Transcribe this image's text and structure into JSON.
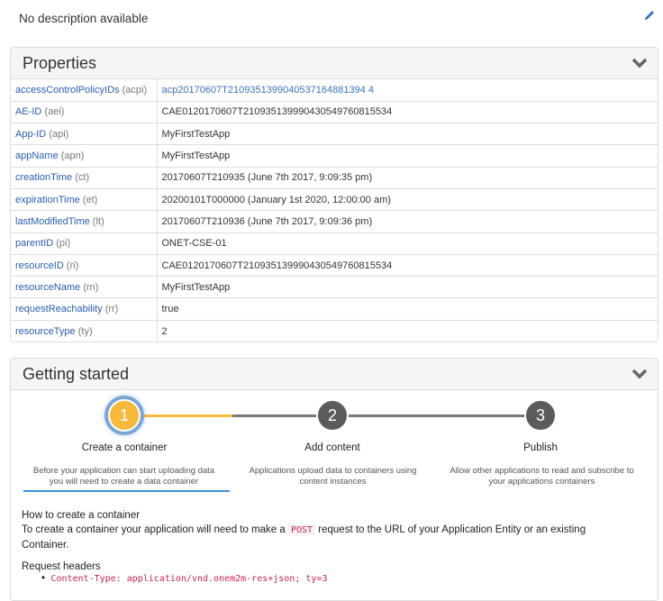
{
  "description": {
    "text": "No description available",
    "edit_icon": "pencil-icon"
  },
  "properties": {
    "title": "Properties",
    "toggle_icon": "chevron-down-icon",
    "rows": [
      {
        "key": "accessControlPolicyIDs",
        "abbr": "(acpi)",
        "value": "acp20170607T2109351399040537164881394 4",
        "link": true
      },
      {
        "key": "AE-ID",
        "abbr": "(aei)",
        "value": "CAE0120170607T210935139990430549760815534",
        "link": false
      },
      {
        "key": "App-ID",
        "abbr": "(api)",
        "value": "MyFirstTestApp",
        "link": false
      },
      {
        "key": "appName",
        "abbr": "(apn)",
        "value": "MyFirstTestApp",
        "link": false
      },
      {
        "key": "creationTime",
        "abbr": "(ct)",
        "value": "20170607T210935 (June 7th 2017, 9:09:35 pm)",
        "link": false
      },
      {
        "key": "expirationTime",
        "abbr": "(et)",
        "value": "20200101T000000 (January 1st 2020, 12:00:00 am)",
        "link": false
      },
      {
        "key": "lastModifiedTime",
        "abbr": "(lt)",
        "value": "20170607T210936 (June 7th 2017, 9:09:36 pm)",
        "link": false
      },
      {
        "key": "parentID",
        "abbr": "(pi)",
        "value": "ONET-CSE-01",
        "link": false
      },
      {
        "key": "resourceID",
        "abbr": "(ri)",
        "value": "CAE0120170607T210935139990430549760815534",
        "link": false
      },
      {
        "key": "resourceName",
        "abbr": "(rn)",
        "value": "MyFirstTestApp",
        "link": false
      },
      {
        "key": "requestReachability",
        "abbr": "(rr)",
        "value": "true",
        "link": false
      },
      {
        "key": "resourceType",
        "abbr": "(ty)",
        "value": "2",
        "link": false
      }
    ]
  },
  "getting_started": {
    "title": "Getting started",
    "toggle_icon": "chevron-down-icon",
    "steps": [
      {
        "number": "1",
        "title": "Create a container",
        "desc1": "Before your application can start uploading data",
        "desc2": "you will need to create a data container"
      },
      {
        "number": "2",
        "title": "Add content",
        "desc1": "Applications upload data to containers using",
        "desc2": "content instances"
      },
      {
        "number": "3",
        "title": "Publish",
        "desc1": "Allow other applications to read and subscribe to",
        "desc2": "your applications containers"
      }
    ],
    "colors": {
      "active": "#f6b93b",
      "inactive": "#5b5b5b",
      "accent": "#3b8ed8"
    },
    "howto_heading": "How to create a container",
    "howto_text_before": "To create a container your application will need to make a",
    "howto_code": "POST",
    "howto_text_after": "request to the URL of your Application Entity or an existing",
    "howto_text_line2": "Container.",
    "headers_heading": "Request headers",
    "headers": [
      "Content-Type: application/vnd.onem2m-res+json; ty=3"
    ]
  }
}
